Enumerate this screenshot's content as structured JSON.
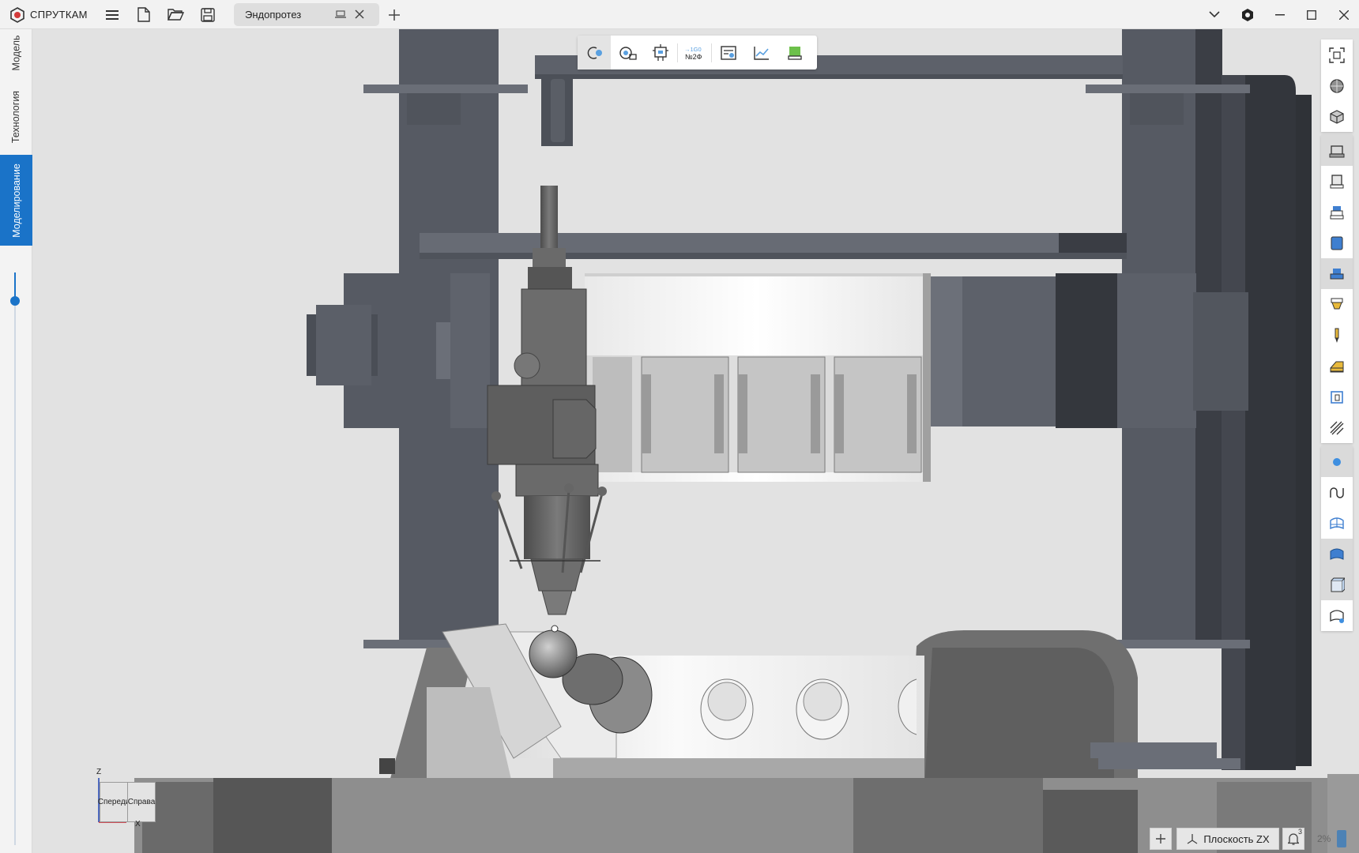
{
  "app": {
    "name": "СПРУТКАМ"
  },
  "titlebar": {
    "menu_icon": "hamburger-icon",
    "new_icon": "new-file-icon",
    "open_icon": "open-folder-icon",
    "save_icon": "save-icon",
    "tab_label": "Эндопротез",
    "add_tab_icon": "plus-icon",
    "chevron_icon": "chevron-down-icon",
    "settings_icon": "gear-icon",
    "minimize_icon": "minimize-icon",
    "maximize_icon": "maximize-icon",
    "close_icon": "close-icon"
  },
  "left_tabs": [
    {
      "label": "Модель",
      "active": false
    },
    {
      "label": "Технология",
      "active": false
    },
    {
      "label": "Моделирование",
      "active": true
    }
  ],
  "timeline_slider": {
    "value_fraction": 0.05
  },
  "top_toolbar": {
    "buttons": [
      {
        "name": "collision-check-icon",
        "active": true
      },
      {
        "name": "machine-setup-icon",
        "active": false
      },
      {
        "name": "tool-holder-icon",
        "active": false
      },
      {
        "name": "nc-program-icon",
        "active": false,
        "text": "→1G0 №2Ф"
      },
      {
        "name": "machine-panel-icon",
        "active": false
      },
      {
        "name": "graph-icon",
        "active": false
      },
      {
        "name": "stock-material-icon",
        "active": false
      }
    ]
  },
  "right_tools": {
    "view": [
      "fit-view-icon",
      "shaded-sphere-icon",
      "wire-box-icon"
    ],
    "machine": [
      "machine-base-icon",
      "machine-frame-icon",
      "machine-head-icon",
      "machine-body-icon",
      "machine-table-icon",
      "spindle-icon",
      "tool-icon",
      "fixture-icon",
      "workpiece-icon",
      "hatching-icon"
    ],
    "display": [
      "point-icon",
      "curve-icon",
      "mesh-icon",
      "surface-icon",
      "solid-icon",
      "surface-edit-icon"
    ]
  },
  "viewcube": {
    "front": "Спереди",
    "right": "Справа",
    "z": "Z",
    "x": "X"
  },
  "bottom": {
    "add_icon": "plus-icon",
    "plane_icon": "axes-icon",
    "plane_label": "Плоскость ZX",
    "notify_icon": "bell-icon",
    "notify_count": "3",
    "percent": "2%"
  },
  "colors": {
    "accent": "#1a73c8",
    "machine_dark": "#4b4f58",
    "machine_mid": "#5f636c",
    "background": "#e2e2e2"
  }
}
